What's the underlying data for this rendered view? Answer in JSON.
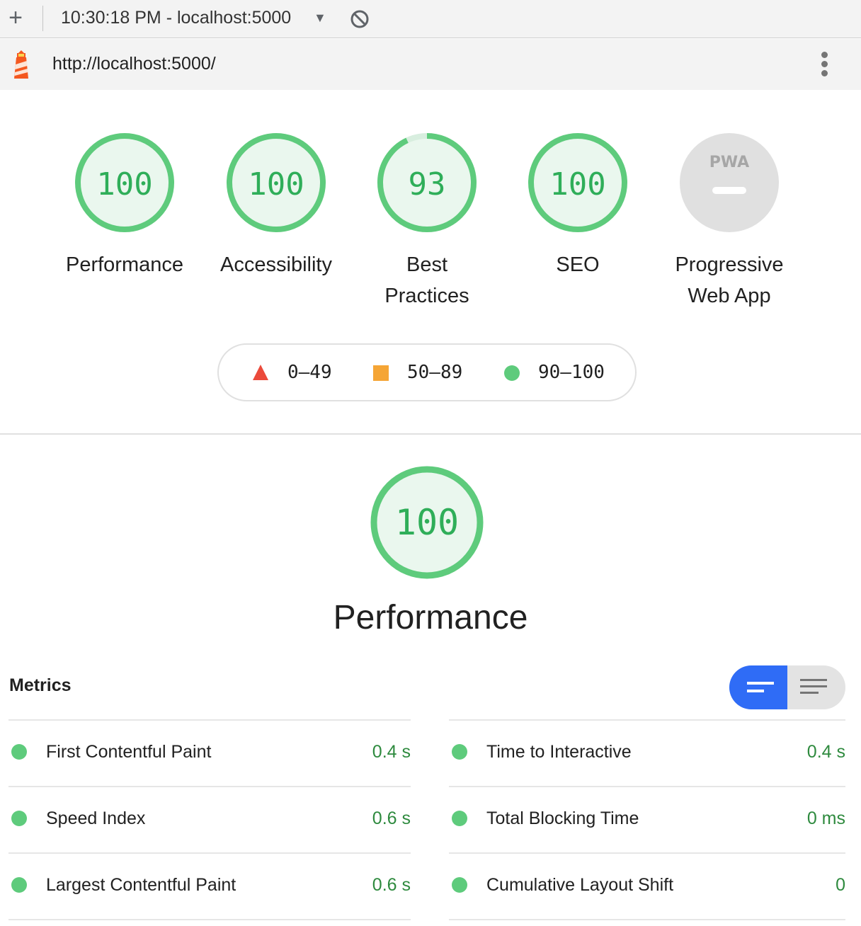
{
  "toolbar": {
    "new_label": "+",
    "session": "10:30:18 PM - localhost:5000",
    "caret": "▼",
    "block_icon": "block-icon"
  },
  "urlbar": {
    "logo_icon": "lighthouse-icon",
    "url": "http://localhost:5000/",
    "menu_icon": "more-vertical-icon"
  },
  "gauges": [
    {
      "score": "100",
      "label_line1": "Performance",
      "label_line2": ""
    },
    {
      "score": "100",
      "label_line1": "Accessibility",
      "label_line2": ""
    },
    {
      "score": "93",
      "label_line1": "Best",
      "label_line2": "Practices"
    },
    {
      "score": "100",
      "label_line1": "SEO",
      "label_line2": ""
    },
    {
      "score": "",
      "badge": "PWA",
      "label_line1": "Progressive",
      "label_line2": "Web App"
    }
  ],
  "scores_numeric": [
    100,
    100,
    93,
    100
  ],
  "legend": {
    "fail": "0–49",
    "average": "50–89",
    "pass": "90–100"
  },
  "performance": {
    "score": "100",
    "title": "Performance"
  },
  "metrics": {
    "title": "Metrics",
    "view_toggle": {
      "left_icon": "compact-view-icon",
      "right_icon": "expanded-view-icon"
    },
    "left": [
      {
        "label": "First Contentful Paint",
        "value": "0.4 s"
      },
      {
        "label": "Speed Index",
        "value": "0.6 s"
      },
      {
        "label": "Largest Contentful Paint",
        "value": "0.6 s"
      }
    ],
    "right": [
      {
        "label": "Time to Interactive",
        "value": "0.4 s"
      },
      {
        "label": "Total Blocking Time",
        "value": "0 ms"
      },
      {
        "label": "Cumulative Layout Shift",
        "value": "0"
      }
    ]
  },
  "colors": {
    "pass": "#5ecb7c",
    "pass_text": "#2fae59",
    "average": "#f5a535",
    "fail": "#eb4a3b",
    "toggle_active": "#2f6cf6"
  }
}
